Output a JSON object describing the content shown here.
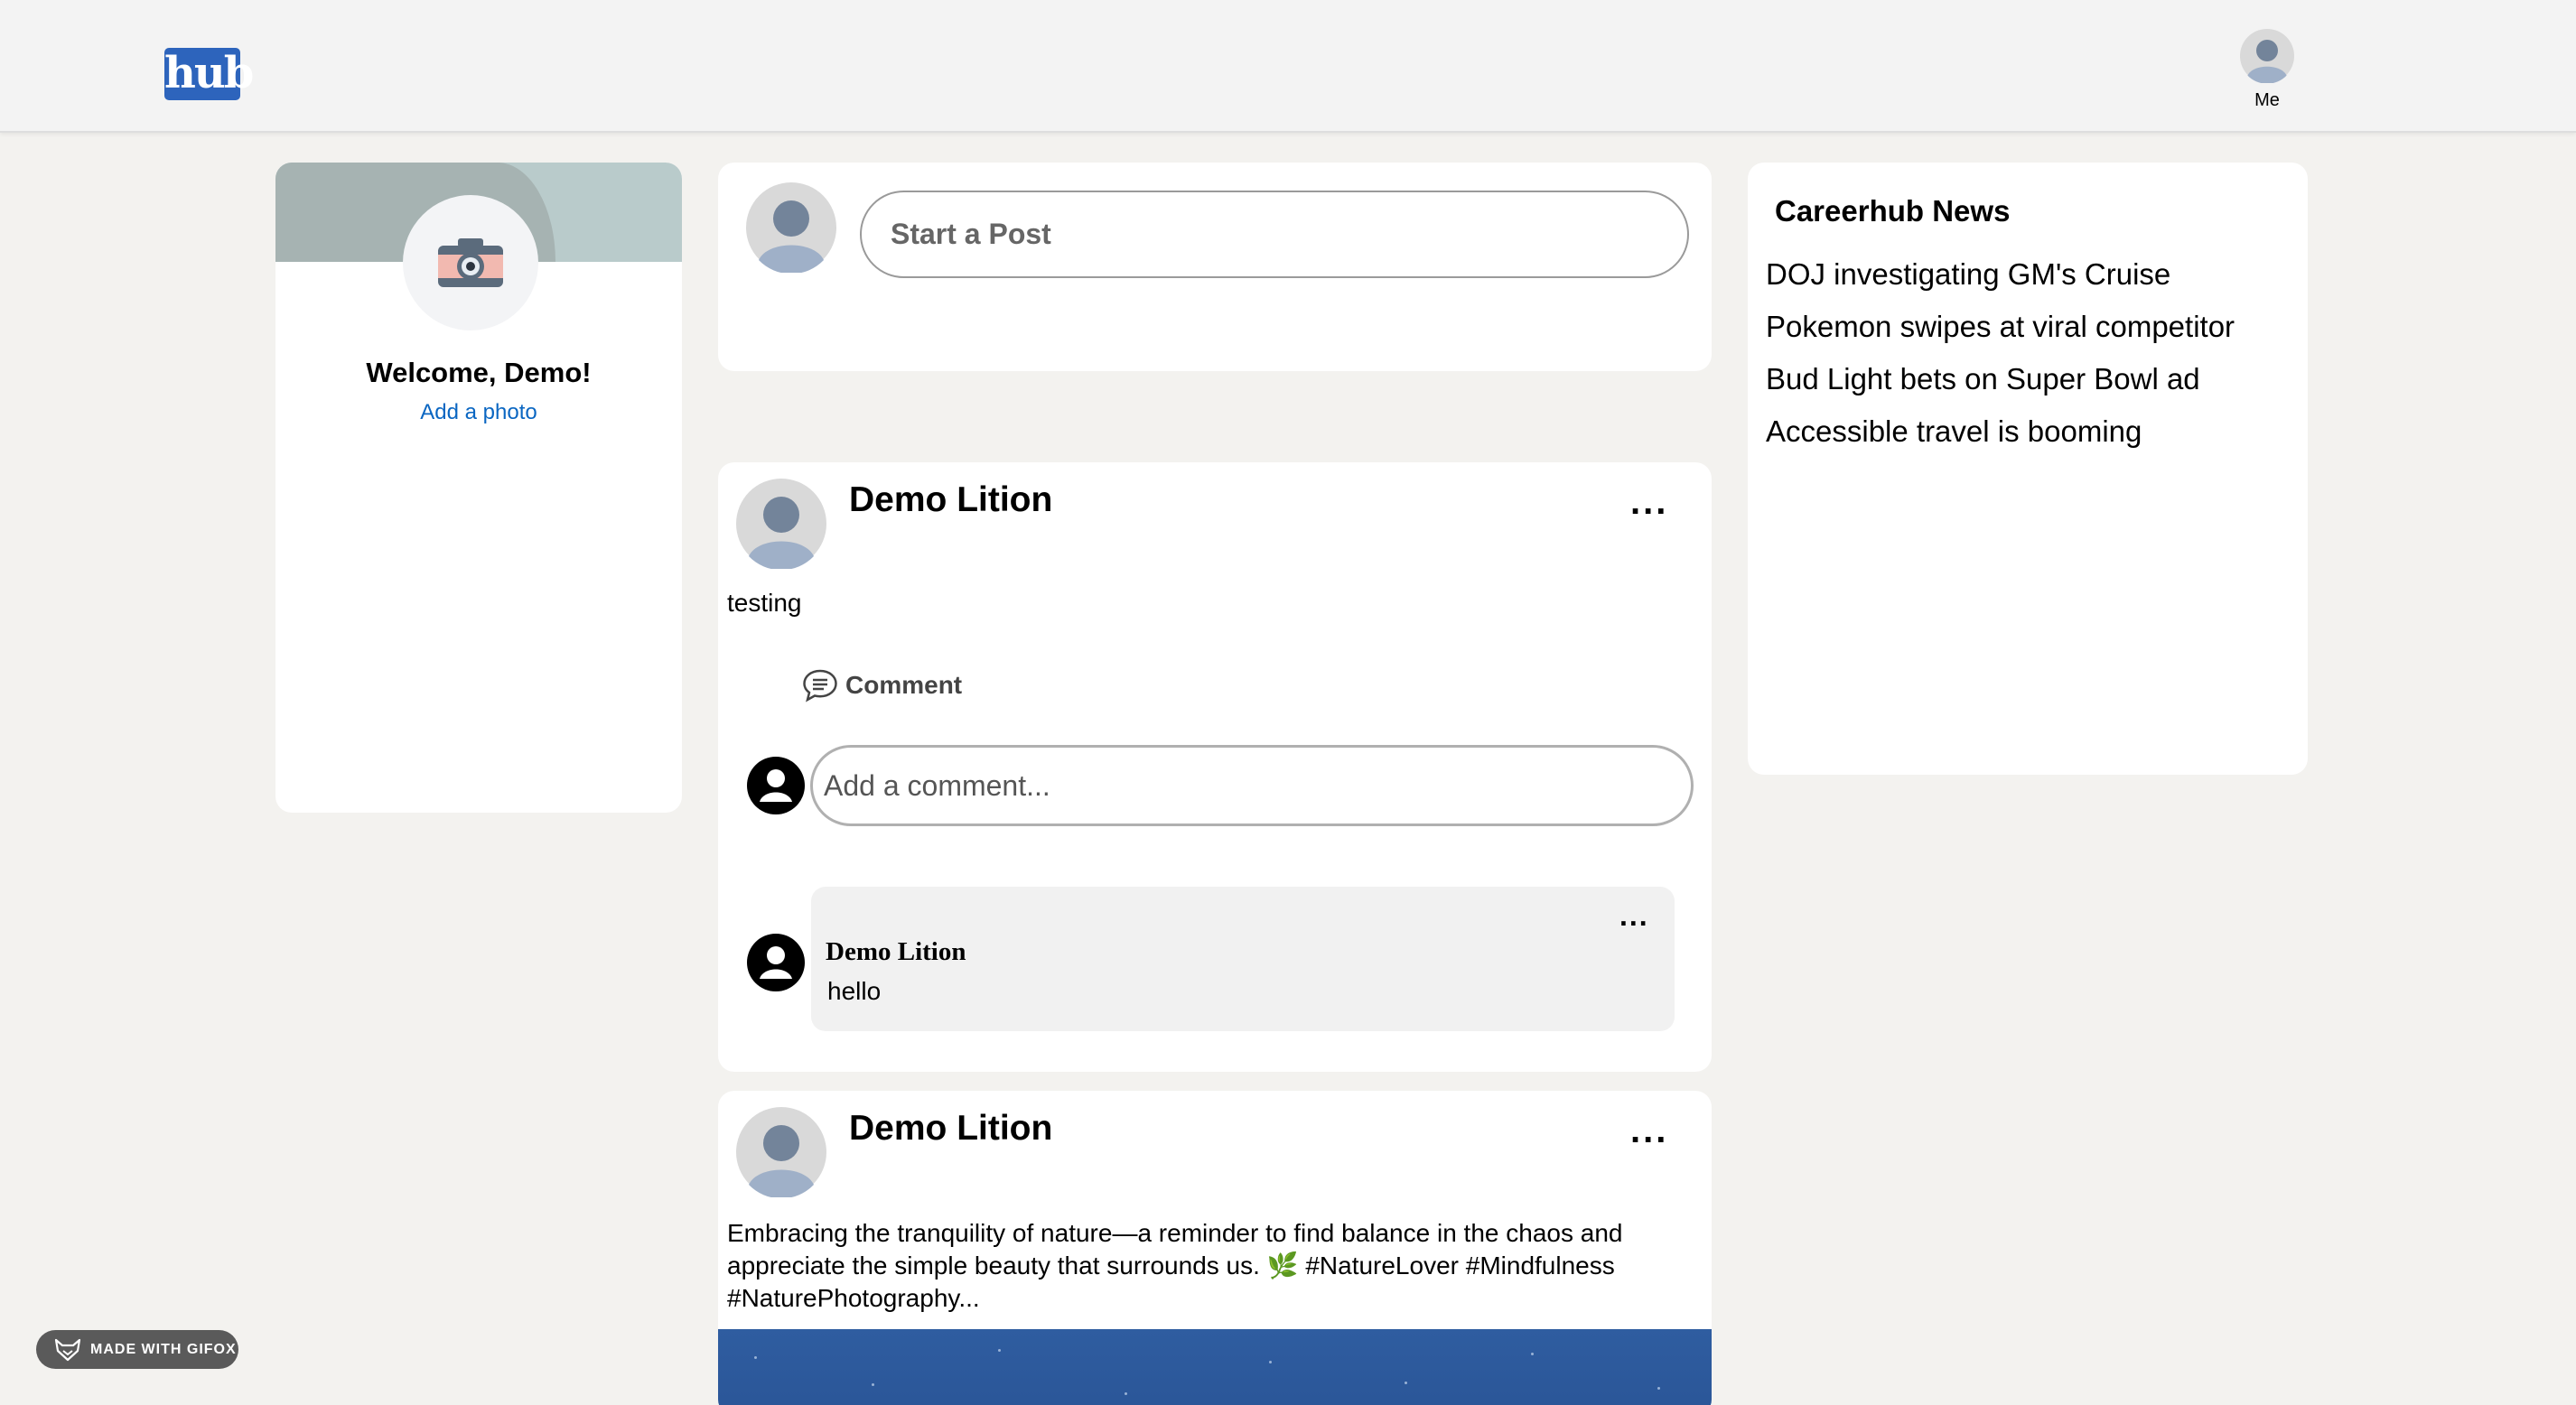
{
  "header": {
    "logo_text": "hub",
    "me_label": "Me"
  },
  "profile": {
    "welcome": "Welcome, Demo!",
    "add_photo": "Add a photo"
  },
  "composer": {
    "placeholder": "Start a Post"
  },
  "posts": [
    {
      "author": "Demo Lition",
      "body": "testing",
      "menu": "...",
      "comment_label": "Comment",
      "comment_placeholder": "Add a comment...",
      "comments": [
        {
          "author": "Demo Lition",
          "text": "hello",
          "menu": "..."
        }
      ]
    },
    {
      "author": "Demo Lition",
      "body": "Embracing the tranquility of nature—a reminder to find balance in the chaos and appreciate the simple beauty that surrounds us. 🌿 #NatureLover #Mindfulness #NaturePhotography...",
      "menu": "..."
    }
  ],
  "news": {
    "title": "Careerhub News",
    "items": [
      "DOJ investigating GM's Cruise",
      "Pokemon swipes at viral competitor",
      "Bud Light bets on Super Bowl ad",
      "Accessible travel is booming"
    ]
  },
  "badge": {
    "label": "MADE WITH GIFOX"
  },
  "colors": {
    "brand": "#2d64bc",
    "link": "#0a66c2",
    "background": "#f3f2ef"
  }
}
